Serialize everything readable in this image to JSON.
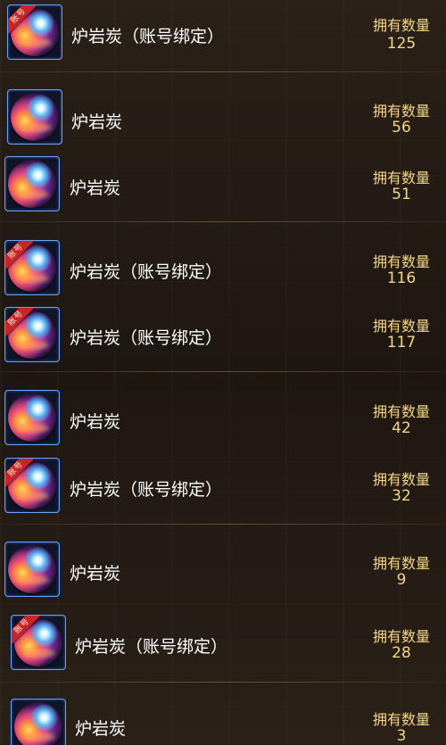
{
  "count_label": "拥有数量",
  "items": [
    {
      "name": "炉岩炭（账号绑定）",
      "count": "125",
      "bound": true
    },
    {
      "name": "炉岩炭",
      "count": "56",
      "bound": false
    },
    {
      "name": "炉岩炭",
      "count": "51",
      "bound": false
    },
    {
      "name": "炉岩炭（账号绑定）",
      "count": "116",
      "bound": true
    },
    {
      "name": "炉岩炭（账号绑定）",
      "count": "117",
      "bound": true
    },
    {
      "name": "炉岩炭",
      "count": "42",
      "bound": false
    },
    {
      "name": "炉岩炭（账号绑定）",
      "count": "32",
      "bound": true
    },
    {
      "name": "炉岩炭",
      "count": "9",
      "bound": false
    },
    {
      "name": "炉岩炭（账号绑定）",
      "count": "28",
      "bound": true
    },
    {
      "name": "炉岩炭",
      "count": "3",
      "bound": false
    }
  ],
  "bound_badge": "账号",
  "icon": "furnace-rock-charcoal-orb-icon",
  "colors": {
    "count_text": "#f3d58a",
    "name_text": "#ffffff",
    "frame": "#6aa0ff",
    "badge": "#c8242a"
  }
}
